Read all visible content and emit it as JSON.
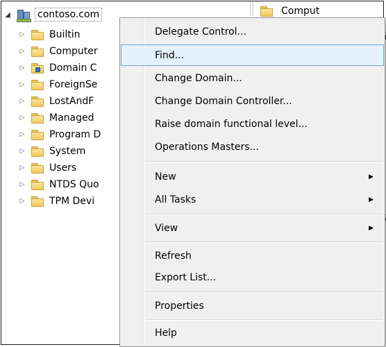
{
  "tree": {
    "root": {
      "label": "contoso.com",
      "expanded": true
    },
    "items": [
      {
        "label": "Builtin",
        "icon": "folder-icon"
      },
      {
        "label": "Computer",
        "icon": "folder-icon"
      },
      {
        "label": "Domain C",
        "icon": "ou-folder-icon"
      },
      {
        "label": "ForeignSe",
        "icon": "folder-icon"
      },
      {
        "label": "LostAndF",
        "icon": "folder-icon"
      },
      {
        "label": "Managed",
        "icon": "folder-icon"
      },
      {
        "label": "Program D",
        "icon": "folder-icon"
      },
      {
        "label": "System",
        "icon": "folder-icon"
      },
      {
        "label": "Users",
        "icon": "folder-icon"
      },
      {
        "label": "NTDS Quo",
        "icon": "folder-icon"
      },
      {
        "label": "TPM Devi",
        "icon": "folder-icon"
      }
    ]
  },
  "right_pane": {
    "first_item": "Comput",
    "edge_text_1": "n",
    "edge_text_2": "5"
  },
  "context_menu": {
    "items": [
      {
        "label": "Delegate Control..."
      },
      {
        "label": "Find...",
        "highlighted": true
      },
      {
        "label": "Change Domain..."
      },
      {
        "label": "Change Domain Controller..."
      },
      {
        "label": "Raise domain functional level..."
      },
      {
        "label": "Operations Masters..."
      },
      {
        "label": "New",
        "submenu": true
      },
      {
        "label": "All Tasks",
        "submenu": true
      },
      {
        "label": "View",
        "submenu": true
      },
      {
        "label": "Refresh"
      },
      {
        "label": "Export List..."
      },
      {
        "label": "Properties"
      },
      {
        "label": "Help"
      }
    ],
    "submenu_arrow": "▶"
  },
  "colors": {
    "highlight_bg": "#e5f1fb",
    "highlight_border": "#6ea7db",
    "menu_bg": "#f0f0f0"
  }
}
